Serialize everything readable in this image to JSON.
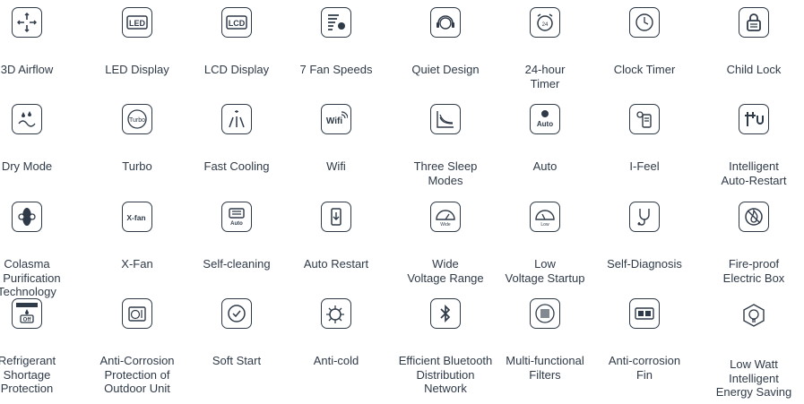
{
  "features": [
    {
      "label": "3D Airflow",
      "icon": "3d-airflow-icon"
    },
    {
      "label": "LED Display",
      "icon": "led-display-icon"
    },
    {
      "label": "LCD Display",
      "icon": "lcd-display-icon"
    },
    {
      "label": "7 Fan Speeds",
      "icon": "fan-speeds-icon"
    },
    {
      "label": "Quiet Design",
      "icon": "quiet-design-icon"
    },
    {
      "label": "24-hour\nTimer",
      "icon": "alarm-clock-icon"
    },
    {
      "label": "Clock Timer",
      "icon": "clock-timer-icon"
    },
    {
      "label": "Child Lock",
      "icon": "lock-icon"
    },
    {
      "label": "Dry Mode",
      "icon": "dry-mode-icon"
    },
    {
      "label": "Turbo",
      "icon": "turbo-icon"
    },
    {
      "label": "Fast Cooling",
      "icon": "fast-cooling-icon"
    },
    {
      "label": "Wifi",
      "icon": "wifi-icon"
    },
    {
      "label": "Three Sleep\nModes",
      "icon": "sleep-modes-icon"
    },
    {
      "label": "Auto",
      "icon": "auto-icon"
    },
    {
      "label": "I-Feel",
      "icon": "i-feel-icon"
    },
    {
      "label": "Intelligent\nAuto-Restart",
      "icon": "auto-restart-plug-icon"
    },
    {
      "label": "Colasma\nir Purification\nTechnology",
      "icon": "air-purification-icon"
    },
    {
      "label": "X-Fan",
      "icon": "x-fan-icon"
    },
    {
      "label": "Self-cleaning",
      "icon": "self-cleaning-icon"
    },
    {
      "label": "Auto Restart",
      "icon": "auto-restart-icon"
    },
    {
      "label": "Wide\nVoltage Range",
      "icon": "wide-voltage-icon"
    },
    {
      "label": "Low\nVoltage Startup",
      "icon": "low-voltage-icon"
    },
    {
      "label": "Self-Diagnosis",
      "icon": "stethoscope-icon"
    },
    {
      "label": "Fire-proof\nElectric Box",
      "icon": "fire-proof-icon"
    },
    {
      "label": "Refrigerant\nShortage\nProtection",
      "icon": "refrigerant-icon"
    },
    {
      "label": "Anti-Corrosion\nProtection of\nOutdoor Unit",
      "icon": "outdoor-unit-icon"
    },
    {
      "label": "Soft Start",
      "icon": "soft-start-icon"
    },
    {
      "label": "Anti-cold",
      "icon": "anti-cold-icon"
    },
    {
      "label": "Efficient Bluetooth\nDistribution Network",
      "icon": "bluetooth-icon"
    },
    {
      "label": "Multi-functional\nFilters",
      "icon": "filter-icon"
    },
    {
      "label": "Anti-corrosion\nFin",
      "icon": "fin-icon"
    },
    {
      "label": "Low Watt\nIntelligent\nEnergy Saving",
      "icon": "energy-saving-icon"
    }
  ],
  "icon_text": {
    "led": "LED",
    "lcd": "LCD",
    "turbo": "Turbo",
    "auto": "Auto",
    "wifi": "Wifi",
    "xfan": "X-fan",
    "off": "Off",
    "wide": "Wide",
    "low": "Low"
  },
  "colors": {
    "ink": "#2f3a48",
    "background": "#ffffff"
  }
}
